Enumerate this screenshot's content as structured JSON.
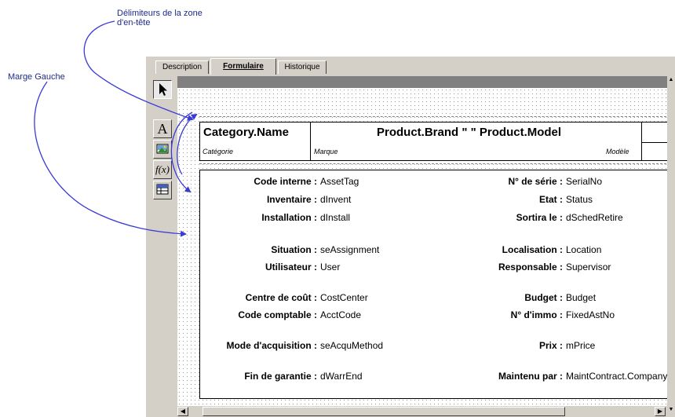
{
  "annotations": {
    "header_delimiters": [
      "Délimiteurs de la zone",
      "d'en-tête"
    ],
    "left_margin": "Marge Gauche"
  },
  "tabs": [
    {
      "label": "Description",
      "active": false
    },
    {
      "label": "Formulaire",
      "active": true
    },
    {
      "label": "Historique",
      "active": false
    }
  ],
  "toolbox": {
    "items": [
      {
        "name": "pointer-tool-icon"
      },
      {
        "name": "text-tool-icon",
        "glyph": "A"
      },
      {
        "name": "image-tool-icon"
      },
      {
        "name": "formula-tool-icon",
        "glyph": "f(x)"
      },
      {
        "name": "table-tool-icon"
      }
    ]
  },
  "header_zone": {
    "category_field": "Category.Name",
    "brand_model_field": "Product.Brand \" \" Product.Model",
    "category_label": "Catégorie",
    "brand_label": "Marque",
    "model_label": "Modèle"
  },
  "form_fields": {
    "left": [
      {
        "label": "Code interne :",
        "value": "AssetTag"
      },
      {
        "label": "Inventaire :",
        "value": "dInvent"
      },
      {
        "label": "Installation :",
        "value": "dInstall"
      },
      {
        "label": "Situation :",
        "value": "seAssignment"
      },
      {
        "label": "Utilisateur :",
        "value": "User"
      },
      {
        "label": "Centre de coût :",
        "value": "CostCenter"
      },
      {
        "label": "Code comptable :",
        "value": "AcctCode"
      },
      {
        "label": "Mode d'acquisition :",
        "value": "seAcquMethod"
      },
      {
        "label": "Fin de garantie :",
        "value": "dWarrEnd"
      }
    ],
    "right": [
      {
        "label": "N° de série :",
        "value": "SerialNo"
      },
      {
        "label": "Etat :",
        "value": "Status"
      },
      {
        "label": "Sortira le :",
        "value": "dSchedRetire"
      },
      {
        "label": "Localisation :",
        "value": "Location"
      },
      {
        "label": "Responsable :",
        "value": "Supervisor"
      },
      {
        "label": "Budget :",
        "value": "Budget"
      },
      {
        "label": "N° d'immo :",
        "value": "FixedAstNo"
      },
      {
        "label": "Prix :",
        "value": "mPrice"
      },
      {
        "label": "Maintenu par :",
        "value": "MaintContract.Company"
      }
    ]
  },
  "colors": {
    "annotation_text": "#1f2a8a",
    "arrow": "#3a3ad8",
    "window_bg": "#d4d0c8"
  }
}
